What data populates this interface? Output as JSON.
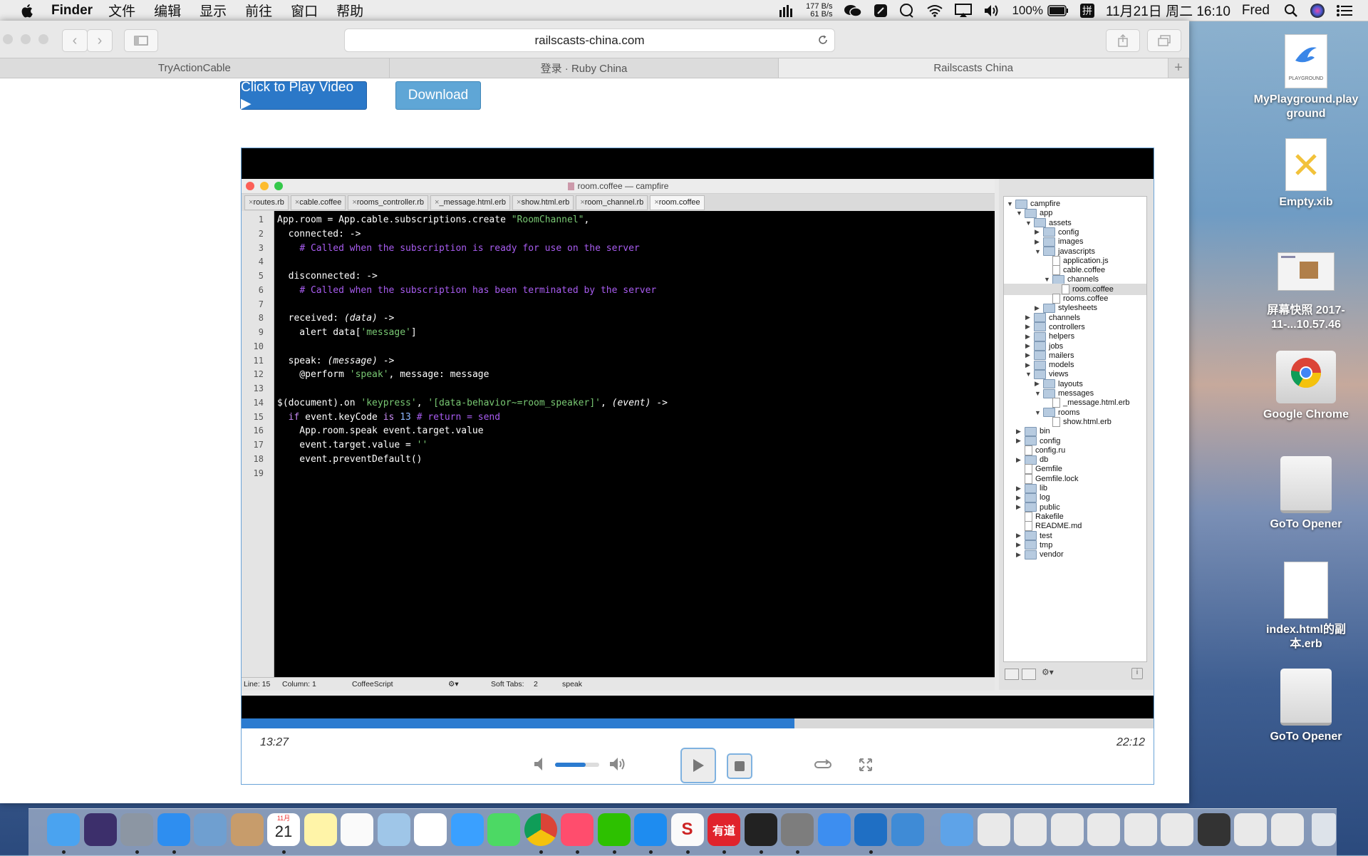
{
  "menubar": {
    "app_name": "Finder",
    "menus": [
      "文件",
      "编辑",
      "显示",
      "前往",
      "窗口",
      "帮助"
    ],
    "net_up": "177 B/s",
    "net_down": "61 B/s",
    "battery": "100%",
    "ime": "拼",
    "datetime": "11月21日 周二 16:10",
    "user": "Fred"
  },
  "browser": {
    "url": "railscasts-china.com",
    "tabs": [
      "TryActionCable",
      "登录 · Ruby China",
      "Railscasts China"
    ],
    "active_tab": 2,
    "play_button": "Click to Play Video ▶",
    "download_button": "Download"
  },
  "editor": {
    "title": "room.coffee — campfire",
    "tabs": [
      "routes.rb",
      "cable.coffee",
      "rooms_controller.rb",
      "_message.html.erb",
      "show.html.erb",
      "room_channel.rb",
      "room.coffee"
    ],
    "active_tab": 6,
    "line_numbers": [
      "1",
      "2",
      "3",
      "4",
      "5",
      "6",
      "7",
      "8",
      "9",
      "10",
      "11",
      "12",
      "13",
      "14",
      "15",
      "16",
      "17",
      "18",
      "19"
    ],
    "code": [
      "App.room = App.cable.subscriptions.create \"RoomChannel\",",
      "  connected: ->",
      "    # Called when the subscription is ready for use on the server",
      "",
      "  disconnected: ->",
      "    # Called when the subscription has been terminated by the server",
      "",
      "  received: (data) ->",
      "    alert data['message']",
      "",
      "  speak: (message) ->",
      "    @perform 'speak', message: message",
      "",
      "$(document).on 'keypress', '[data-behavior~=room_speaker]', (event) ->",
      "  if event.keyCode is 13 # return = send",
      "    App.room.speak event.target.value",
      "    event.target.value = ''",
      "    event.preventDefault()",
      ""
    ],
    "status": {
      "line": "Line: 15",
      "column": "Column: 1",
      "language": "CoffeeScript",
      "soft_tabs": "Soft Tabs:",
      "tab_size": "2",
      "symbol": "speak"
    },
    "tree": [
      {
        "name": "campfire",
        "d": 0,
        "t": "dir",
        "open": true
      },
      {
        "name": "app",
        "d": 1,
        "t": "dir",
        "open": true
      },
      {
        "name": "assets",
        "d": 2,
        "t": "dir",
        "open": true
      },
      {
        "name": "config",
        "d": 3,
        "t": "dir",
        "open": false
      },
      {
        "name": "images",
        "d": 3,
        "t": "dir",
        "open": false
      },
      {
        "name": "javascripts",
        "d": 3,
        "t": "dir",
        "open": true
      },
      {
        "name": "application.js",
        "d": 4,
        "t": "file"
      },
      {
        "name": "cable.coffee",
        "d": 4,
        "t": "file"
      },
      {
        "name": "channels",
        "d": 4,
        "t": "dir",
        "open": true
      },
      {
        "name": "room.coffee",
        "d": 5,
        "t": "file",
        "sel": true
      },
      {
        "name": "rooms.coffee",
        "d": 4,
        "t": "file"
      },
      {
        "name": "stylesheets",
        "d": 3,
        "t": "dir",
        "open": false
      },
      {
        "name": "channels",
        "d": 2,
        "t": "dir",
        "open": false
      },
      {
        "name": "controllers",
        "d": 2,
        "t": "dir",
        "open": false
      },
      {
        "name": "helpers",
        "d": 2,
        "t": "dir",
        "open": false
      },
      {
        "name": "jobs",
        "d": 2,
        "t": "dir",
        "open": false
      },
      {
        "name": "mailers",
        "d": 2,
        "t": "dir",
        "open": false
      },
      {
        "name": "models",
        "d": 2,
        "t": "dir",
        "open": false
      },
      {
        "name": "views",
        "d": 2,
        "t": "dir",
        "open": true
      },
      {
        "name": "layouts",
        "d": 3,
        "t": "dir",
        "open": false
      },
      {
        "name": "messages",
        "d": 3,
        "t": "dir",
        "open": true
      },
      {
        "name": "_message.html.erb",
        "d": 4,
        "t": "file"
      },
      {
        "name": "rooms",
        "d": 3,
        "t": "dir",
        "open": true
      },
      {
        "name": "show.html.erb",
        "d": 4,
        "t": "file"
      },
      {
        "name": "bin",
        "d": 1,
        "t": "dir",
        "open": false
      },
      {
        "name": "config",
        "d": 1,
        "t": "dir",
        "open": false
      },
      {
        "name": "config.ru",
        "d": 1,
        "t": "file"
      },
      {
        "name": "db",
        "d": 1,
        "t": "dir",
        "open": false
      },
      {
        "name": "Gemfile",
        "d": 1,
        "t": "file"
      },
      {
        "name": "Gemfile.lock",
        "d": 1,
        "t": "file"
      },
      {
        "name": "lib",
        "d": 1,
        "t": "dir",
        "open": false
      },
      {
        "name": "log",
        "d": 1,
        "t": "dir",
        "open": false
      },
      {
        "name": "public",
        "d": 1,
        "t": "dir",
        "open": false
      },
      {
        "name": "Rakefile",
        "d": 1,
        "t": "file"
      },
      {
        "name": "README.md",
        "d": 1,
        "t": "file"
      },
      {
        "name": "test",
        "d": 1,
        "t": "dir",
        "open": false
      },
      {
        "name": "tmp",
        "d": 1,
        "t": "dir",
        "open": false
      },
      {
        "name": "vendor",
        "d": 1,
        "t": "dir",
        "open": false
      }
    ]
  },
  "player": {
    "current_time": "13:27",
    "total_time": "22:12",
    "progress": 0.606,
    "volume": 0.7,
    "icons": [
      "volume-mute-icon",
      "volume-up-icon",
      "play-icon",
      "stop-icon",
      "loop-icon",
      "fullscreen-icon"
    ]
  },
  "desktop_icons": [
    {
      "label": "MyPlayground.playground",
      "badge": "PLAYGROUND"
    },
    {
      "label": "Empty.xib"
    },
    {
      "label": "屏幕快照 2017-11-...10.57.46"
    },
    {
      "label": "Google Chrome"
    },
    {
      "label": "GoTo Opener"
    },
    {
      "label": "index.html的副本.erb"
    },
    {
      "label": "GoTo Opener"
    }
  ],
  "dock": {
    "calendar_month": "11月",
    "calendar_day": "21",
    "youdao": "有道",
    "sheets": "S",
    "running_apps": [
      "finder",
      "launchpad",
      "safari",
      "calendar",
      "chrome",
      "music",
      "wechat",
      "app-store",
      "sheets",
      "youdao",
      "terminal",
      "preferences",
      "vscode"
    ]
  },
  "colors": {
    "progress": "#2b7bd0",
    "play_button": "#2b78c8",
    "download_button": "#5fa6d6",
    "code_comment": "#a85cf0",
    "code_string": "#79c873",
    "code_keyword": "#c98bf5"
  }
}
